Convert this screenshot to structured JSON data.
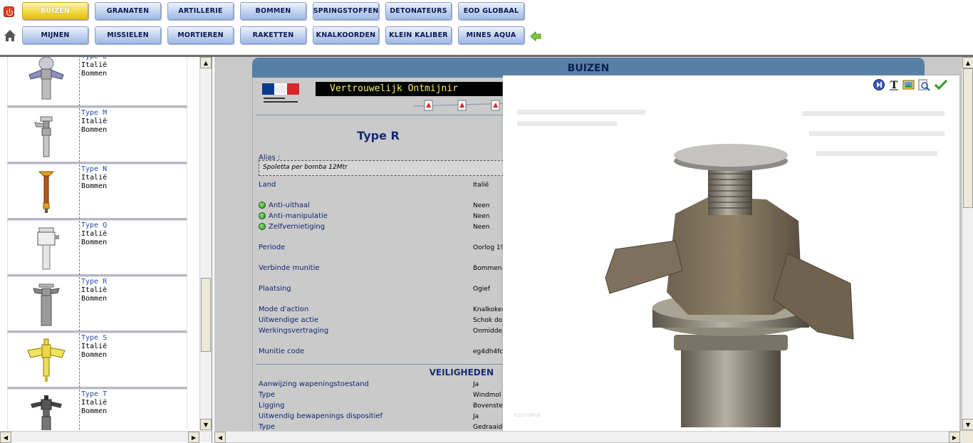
{
  "nav": {
    "row1": [
      "BUIZEN",
      "GRANATEN",
      "ARTILLERIE",
      "BOMMEN",
      "SPRINGSTOFFEN",
      "DETONATEURS",
      "EOD GLOBAAL"
    ],
    "row2": [
      "MIJNEN",
      "MISSIELEN",
      "MORTIEREN",
      "RAKETTEN",
      "KNALKOORDEN",
      "KLEIN KALIBER",
      "MINES AQUA"
    ],
    "active": "BUIZEN"
  },
  "list": [
    {
      "type": "Type L",
      "country": "Italië",
      "category": "Bommen"
    },
    {
      "type": "Type M",
      "country": "Italië",
      "category": "Bommen"
    },
    {
      "type": "Type N",
      "country": "Italië",
      "category": "Bommen"
    },
    {
      "type": "Type Q",
      "country": "Italië",
      "category": "Bommen"
    },
    {
      "type": "Type R",
      "country": "Italië",
      "category": "Bommen"
    },
    {
      "type": "Type S",
      "country": "Italië",
      "category": "Bommen"
    },
    {
      "type": "Type T",
      "country": "Italië",
      "category": "Bommen"
    }
  ],
  "main": {
    "banner": "BUIZEN",
    "confidential": "Vertrouwelijk Ontmijnir",
    "title": "Type R",
    "alias_label": "Alias :",
    "alias_value": "Spoletta per bomba 12Mtr",
    "land_label": "Land",
    "land_value": "Italië",
    "anti_uithaal_label": "Anti-uithaal",
    "anti_uithaal_value": "Neen",
    "anti_manipulatie_label": "Anti-manipulatie",
    "anti_manipulatie_value": "Neen",
    "zelfvernietiging_label": "Zelfvernietiging",
    "zelfvernietiging_value": "Neen",
    "periode_label": "Periode",
    "periode_value": "Oorlog 19",
    "verbinde_label": "Verbinde munitie",
    "verbinde_value": "Bommen",
    "plaatsing_label": "Plaatsing",
    "plaatsing_value": "Ogief",
    "mode_label": "Mode d'action",
    "mode_value": "Knalkoker",
    "uitwendige_label": "Uitwendige actie",
    "uitwendige_value": "Schok do",
    "werkings_label": "Werkingsvertraging",
    "werkings_value": "Onmidde",
    "code_label": "Munitie code",
    "code_value": "eg4dh4fc",
    "veiligheden_title": "VEILIGHEDEN",
    "aanwijzing_label": "Aanwijzing wapeningstoestand",
    "aanwijzing_value": "Ja",
    "type1_label": "Type",
    "type1_value": "Windmol",
    "ligging_label": "Ligging",
    "ligging_value": "Bovenste",
    "uitwendig_bew_label": "Uitwendig bewapenings dispositief",
    "uitwendig_bew_value": "Ja",
    "type2_label": "Type",
    "type2_value": "Gedraaid"
  },
  "popup": {
    "credit": "EOD-TURPIN"
  },
  "colors": {
    "accent_banner": "#5680a8",
    "active_button": "#f2d744",
    "nav_button": "#b5c9ee",
    "label_text": "#142573"
  }
}
